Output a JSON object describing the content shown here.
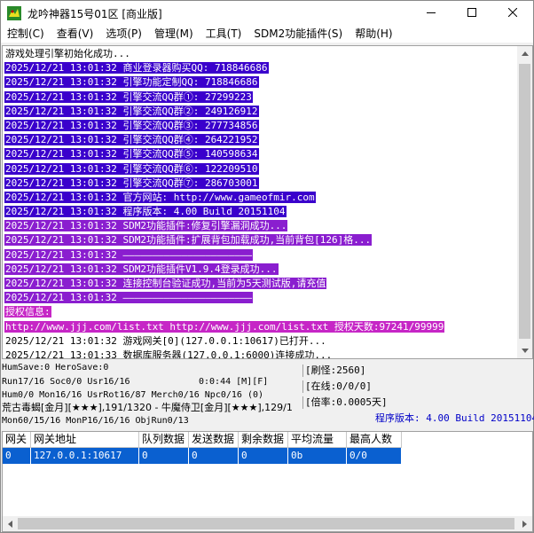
{
  "window": {
    "title": "龙吟神器15号01区 [商业版]"
  },
  "menu": [
    "控制(C)",
    "查看(V)",
    "选项(P)",
    "管理(M)",
    "工具(T)",
    "SDM2功能插件(S)",
    "帮助(H)"
  ],
  "log": {
    "lines": [
      {
        "text": "游戏处理引擎初始化成功...",
        "hl": "none"
      },
      {
        "text": "2025/12/21 13:01:32 商业登录器购买QQ: 718846686",
        "hl": "blue"
      },
      {
        "text": "2025/12/21 13:01:32 引擎功能定制QQ: 718846686",
        "hl": "blue"
      },
      {
        "text": "2025/12/21 13:01:32 引擎交流QQ群①: 27299223",
        "hl": "blue"
      },
      {
        "text": "2025/12/21 13:01:32 引擎交流QQ群②: 249126912",
        "hl": "blue"
      },
      {
        "text": "2025/12/21 13:01:32 引擎交流QQ群③: 277734856",
        "hl": "blue"
      },
      {
        "text": "2025/12/21 13:01:32 引擎交流QQ群④: 264221952",
        "hl": "blue"
      },
      {
        "text": "2025/12/21 13:01:32 引擎交流QQ群⑤: 140598634",
        "hl": "blue"
      },
      {
        "text": "2025/12/21 13:01:32 引擎交流QQ群⑥: 122209510",
        "hl": "blue"
      },
      {
        "text": "2025/12/21 13:01:32 引擎交流QQ群⑦: 286703001",
        "hl": "blue"
      },
      {
        "text": "2025/12/21 13:01:32 官方网站: http://www.gameofmir.com",
        "hl": "blue"
      },
      {
        "text": "2025/12/21 13:01:32 程序版本: 4.00 Build 20151104",
        "hl": "blue"
      },
      {
        "text": "2025/12/21 13:01:32 SDM2功能插件:修复引擎漏洞成功...",
        "hl": "purple"
      },
      {
        "text": "2025/12/21 13:01:32 SDM2功能插件:扩展背包加载成功,当前背包[126]格...",
        "hl": "purple"
      },
      {
        "text": "2025/12/21 13:01:32 ——————————————————————",
        "hl": "purple"
      },
      {
        "text": "2025/12/21 13:01:32 SDM2功能插件V1.9.4登录成功...",
        "hl": "purple"
      },
      {
        "text": "2025/12/21 13:01:32 连接控制台验证成功,当前为5天测试版,请充值",
        "hl": "purple"
      },
      {
        "text": "2025/12/21 13:01:32 ——————————————————————",
        "hl": "purple"
      },
      {
        "text": "授权信息:",
        "hl": "magenta"
      },
      {
        "text": "http://www.jjj.com/list.txt http://www.jjj.com/list.txt 授权天数:97241/99999",
        "hl": "magenta"
      },
      {
        "text": "2025/12/21 13:01:32 游戏网关[0](127.0.0.1:10617)已打开...",
        "hl": "none"
      },
      {
        "text": "2025/12/21 13:01:33 数据库服务器(127.0.0.1:6000)连接成功...",
        "hl": "none"
      }
    ]
  },
  "status": {
    "line1": "HumSave:0 HeroSave:0",
    "line2": "Run17/16 Soc0/0 Usr16/16",
    "timer": "0:0:44 [M][F]",
    "line3": "Hum0/0 Mon16/16 UsrRot16/87 Merch0/16 Npc0/16 (0)",
    "line4": "荒古毒蝎[金月][★★★],191/1320 - 牛魔侍卫[金月][★★★],129/1",
    "line5": "Mon60/15/16 MonP16/16/16 ObjRun0/13",
    "refresh": "[刷怪:2560]",
    "online": "[在线:0/0/0]",
    "exp_rate": "[倍率:0.0005天]",
    "version": "程序版本: 4.00 Build 20151104"
  },
  "gateway_table": {
    "headers": [
      "网关",
      "网关地址",
      "队列数据",
      "发送数据",
      "剩余数据",
      "平均流量",
      "最高人数"
    ],
    "row": [
      "0",
      "127.0.0.1:10617",
      "0",
      "0",
      "0",
      "0b",
      "0/0"
    ]
  },
  "icons": {
    "app": "dragon-app-icon",
    "minimize": "minimize-icon",
    "maximize": "maximize-icon",
    "close": "close-icon"
  }
}
